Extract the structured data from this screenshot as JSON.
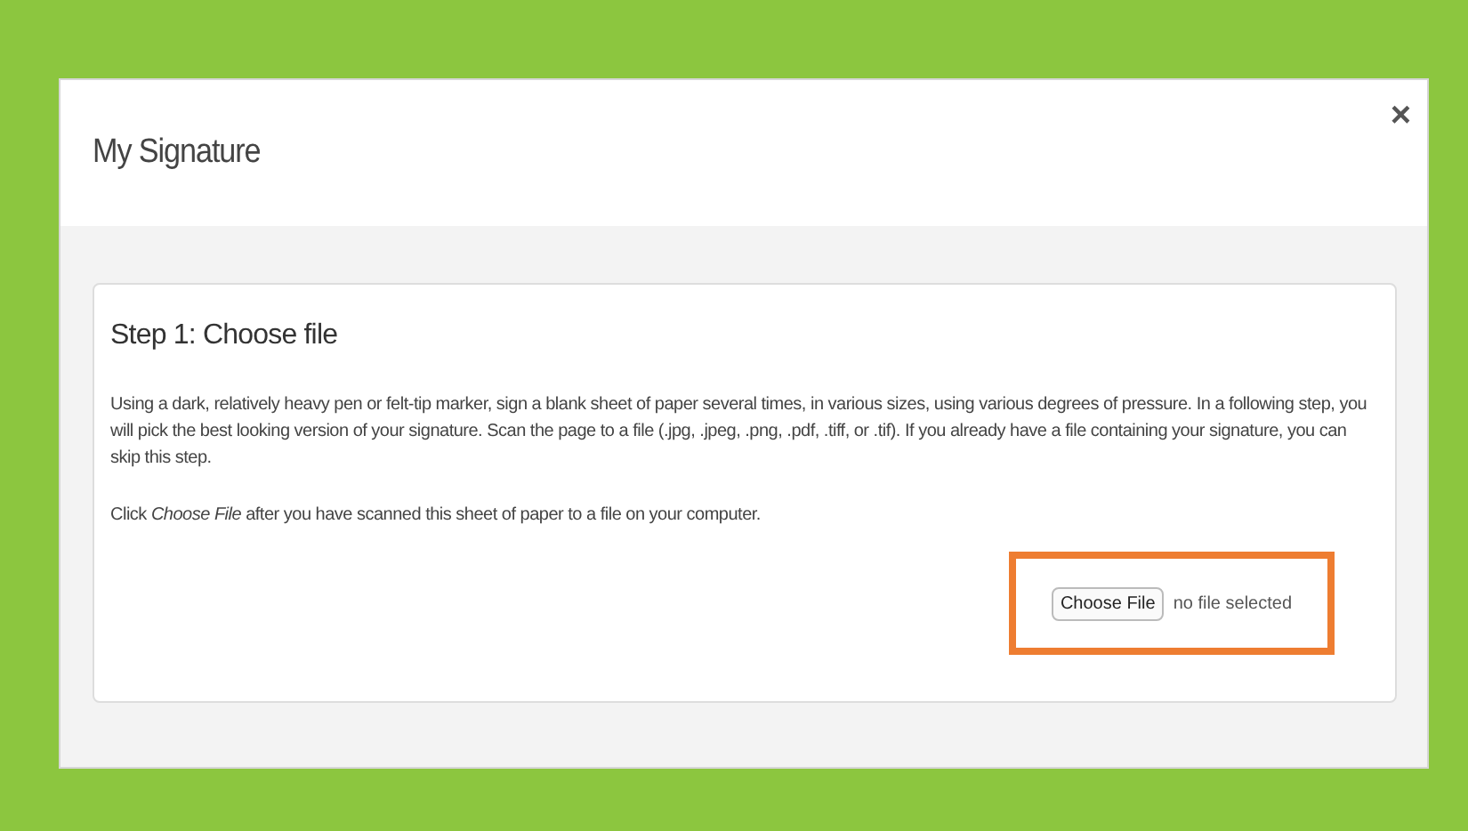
{
  "dialog": {
    "title": "My Signature",
    "close": "×"
  },
  "step": {
    "heading": "Step 1: Choose file",
    "paragraphs": [
      "Using a dark, relatively heavy pen or felt-tip marker, sign a blank sheet of paper several times, in various sizes, using various degrees of pressure. In a following step, you will pick the best looking version of your signature. Scan the page to a file (.jpg, .jpeg, .png, .pdf, .tiff, or .tif). If you already have a file containing your signature, you can skip this step.",
      "Click *Choose File* after you have scanned this sheet of paper to a file on your computer."
    ],
    "file_input": {
      "button": "Choose File",
      "status": "no file selected",
      "highlighted": true
    }
  }
}
